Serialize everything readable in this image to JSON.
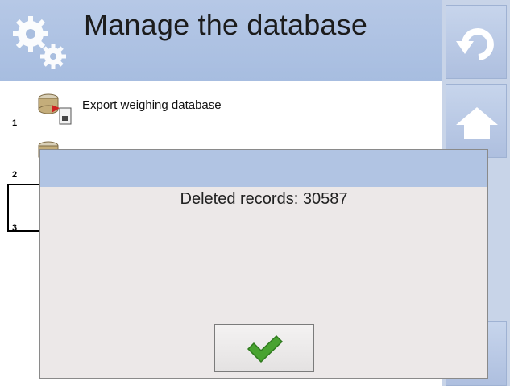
{
  "header": {
    "title": "Manage the database",
    "icon": "gears-icon",
    "color": "#b0c4e4"
  },
  "side_buttons": [
    {
      "name": "back",
      "icon": "undo-arrow-icon"
    },
    {
      "name": "home",
      "icon": "home-icon"
    }
  ],
  "list": {
    "items": [
      {
        "number": "1",
        "label": "Export weighing database",
        "icon": "export-database-icon"
      },
      {
        "number": "2",
        "label": "",
        "icon": "database-icon"
      },
      {
        "number": "3",
        "label": "",
        "icon": "database-icon"
      }
    ],
    "selected_index": 3
  },
  "dialog": {
    "message": "Deleted records: 30587",
    "confirm_icon": "checkmark-icon",
    "title_bar_color": "#b1c4e3",
    "confirm_color": "#4aa531"
  }
}
